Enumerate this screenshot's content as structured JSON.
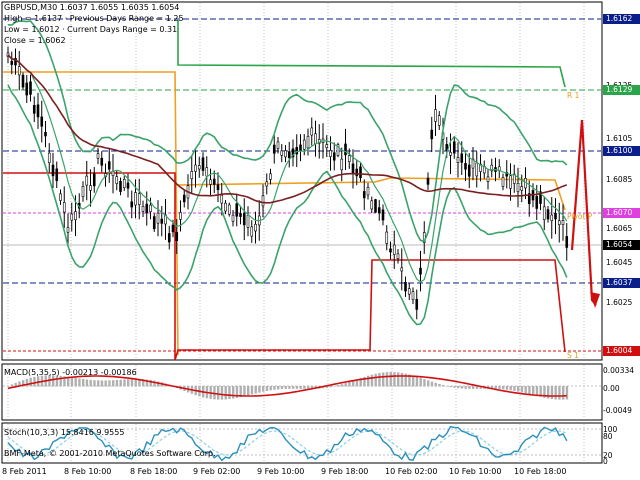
{
  "header": {
    "symbol": "GBPUSD,M30",
    "ohlc": "1.6037 1.6055 1.6035 1.6054",
    "high_line": "High = 1.6137  · Previous Days Range = 1.25",
    "low_line": "Low = 1.6012  · Current Days Range = 0.31",
    "close_line": "Close = 1.6062"
  },
  "price_axis": {
    "plain_labels": [
      "1.6125",
      "1.6105",
      "1.6085",
      "1.6065",
      "1.6045",
      "1.6025"
    ],
    "boxed_labels": [
      {
        "text": "1.6162",
        "color": "#0b1f8a"
      },
      {
        "text": "1.6129",
        "color": "#2aa54a"
      },
      {
        "text": "1.6100",
        "color": "#0b1f8a"
      },
      {
        "text": "1.6070",
        "color": "#e040e0"
      },
      {
        "text": "1.6054",
        "color": "#000000"
      },
      {
        "text": "1.6037",
        "color": "#0b1f8a"
      },
      {
        "text": "1.6004",
        "color": "#d01010"
      }
    ]
  },
  "level_tags": {
    "r1": "R 1",
    "pivot": "Pivot P",
    "s1": "S 1"
  },
  "macd": {
    "label": "MACD(5,35,5) -0.00213 -0.00186",
    "axis": [
      "0.00334",
      "0.00",
      "-0.0049"
    ]
  },
  "stoch": {
    "label": "Stoch(10,3,3) 15.8416 9.9555",
    "axis": [
      "100",
      "80",
      "20",
      "0"
    ]
  },
  "copyright": "BMF-Meta, © 2001-2010 MetaQuotes Software Corp.",
  "time_axis": [
    "8 Feb 2011",
    "8 Feb 10:00",
    "8 Feb 18:00",
    "9 Feb 02:00",
    "9 Feb 10:00",
    "9 Feb 18:00",
    "10 Feb 02:00",
    "10 Feb 10:00",
    "10 Feb 18:00"
  ],
  "colors": {
    "candle": "#000000",
    "bollinger": "#3aa36a",
    "moving_average": "#7a1f1f",
    "resistance": "#2aa54a",
    "support": "#d01010",
    "pivot": "#f0a020",
    "macd_line": "#d01010",
    "stoch_main": "#2a8fbf",
    "stoch_signal": "#8fcfe0"
  }
}
